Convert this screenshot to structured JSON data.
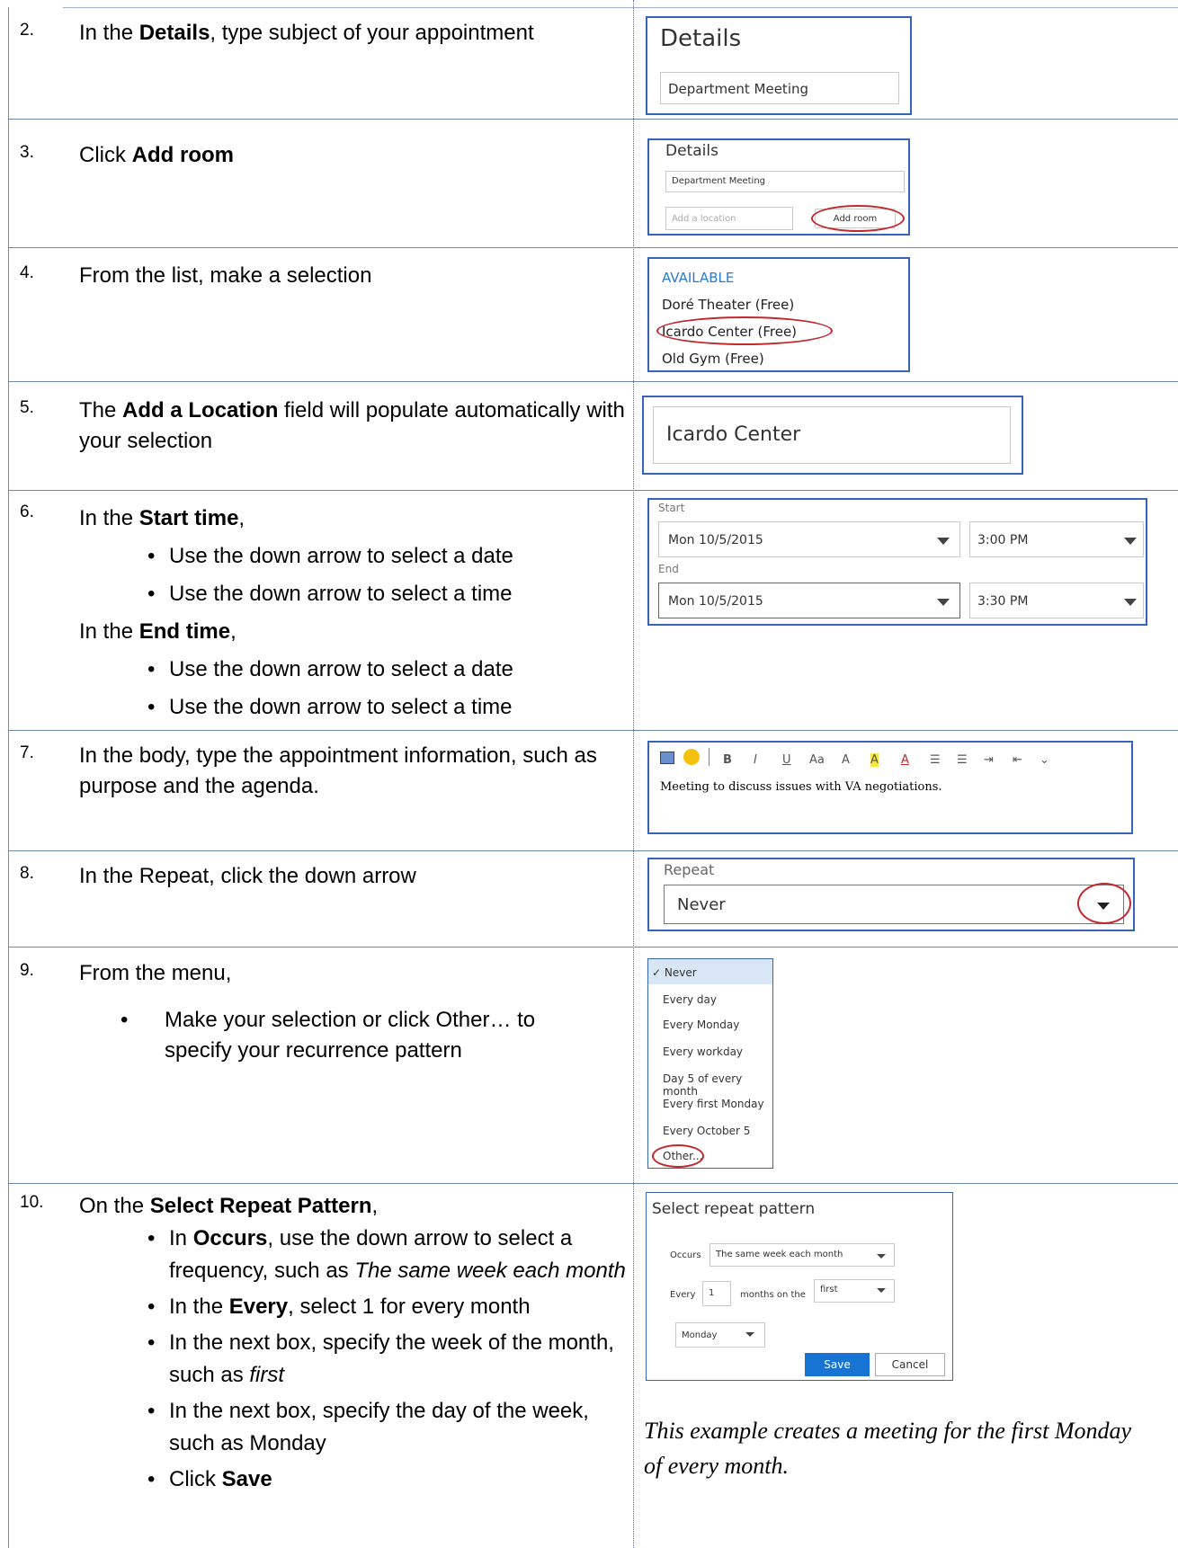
{
  "steps": [
    {
      "num": "2.",
      "pre": "In the ",
      "bold": "Details",
      "post": ", type subject of your appointment"
    },
    {
      "num": "3.",
      "pre": "Click ",
      "bold": "Add room",
      "post": ""
    },
    {
      "num": "4.",
      "text": "From the list, make a selection"
    },
    {
      "num": "5.",
      "pre": "The ",
      "bold": "Add a Location",
      "post": " field will populate automatically with your selection"
    },
    {
      "num": "6.",
      "pre1": "In the ",
      "bold1": "Start time",
      "post1": ",",
      "b1": "Use the down arrow to select a date",
      "b2": "Use the down arrow to select a time",
      "pre2": "In the ",
      "bold2": "End time",
      "post2": ",",
      "b3": "Use the down arrow to select a date",
      "b4": "Use the down arrow to select a time"
    },
    {
      "num": "7.",
      "text": "In the body, type the appointment information, such as purpose and the agenda."
    },
    {
      "num": "8.",
      "text": "In the Repeat, click the down arrow"
    },
    {
      "num": "9.",
      "text": "From the menu,",
      "b1": "Make your selection or click Other… to specify your recurrence pattern"
    },
    {
      "num": "10.",
      "pre": "On the ",
      "bold": "Select Repeat Pattern",
      "post": ",",
      "b1_pre": "In ",
      "b1_bold": "Occurs",
      "b1_post": ", use the down arrow to select a frequency, such as ",
      "b1_em": "The same week each month",
      "b2_pre": "In the ",
      "b2_bold": "Every",
      "b2_post": ", select 1 for every month",
      "b3_pre": "In the next box, specify the week of the month, such as ",
      "b3_em": "first",
      "b4": "In the next box, specify the day of the week, such as Monday",
      "b5_pre": "Click ",
      "b5_bold": "Save"
    }
  ],
  "shots": {
    "details1": {
      "title": "Details",
      "value": "Department Meeting"
    },
    "details2": {
      "title": "Details",
      "value": "Department Meeting",
      "location_placeholder": "Add a location",
      "button": "Add room"
    },
    "available": {
      "header": "AVAILABLE",
      "items": [
        "Doré Theater  (Free)",
        "Icardo Center  (Free)",
        "Old Gym  (Free)"
      ]
    },
    "location": {
      "value": "Icardo Center"
    },
    "times": {
      "start_label": "Start",
      "start_date": "Mon 10/5/2015",
      "start_time": "3:00 PM",
      "end_label": "End",
      "end_date": "Mon 10/5/2015",
      "end_time": "3:30 PM"
    },
    "body": {
      "toolbar": [
        "B",
        "I",
        "U",
        "Aa",
        "A",
        "A",
        "☰",
        "☰",
        "⇥",
        "⇤",
        "⌄"
      ],
      "text": "Meeting to discuss issues with VA negotiations."
    },
    "repeat": {
      "label": "Repeat",
      "value": "Never"
    },
    "menu": {
      "items": [
        "✓ Never",
        "Every day",
        "Every Monday",
        "Every workday",
        "Day 5 of every month",
        "Every first Monday",
        "Every October 5",
        "Other..."
      ]
    },
    "pattern": {
      "title": "Select repeat pattern",
      "occurs_label": "Occurs",
      "occurs_value": "The same week each month",
      "every_label": "Every",
      "every_value": "1",
      "months_on": "months on the",
      "week_value": "first",
      "day_value": "Monday",
      "save": "Save",
      "cancel": "Cancel"
    },
    "note": "This example creates a meeting for the first Monday of every month."
  },
  "colors": {
    "accent": "#3864b8",
    "highlight": "#c0282d",
    "button_blue": "#1874d2"
  }
}
